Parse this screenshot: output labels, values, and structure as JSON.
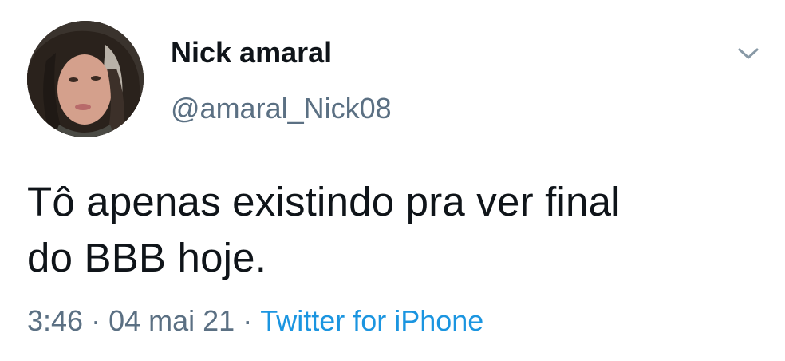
{
  "user": {
    "display_name": "Nick amaral",
    "handle": "@amaral_Nick08"
  },
  "icons": {
    "menu": "chevron-down-icon",
    "avatar": "profile-photo"
  },
  "tweet": {
    "text_line1": "Tô apenas existindo pra ver final",
    "text_line2": "do BBB hoje."
  },
  "meta": {
    "time": "3:46",
    "separator": "·",
    "date": "04 mai 21",
    "source": "Twitter for iPhone"
  },
  "colors": {
    "text": "#0f1419",
    "secondary": "#5b7083",
    "link": "#1b95e0",
    "background": "#ffffff"
  }
}
